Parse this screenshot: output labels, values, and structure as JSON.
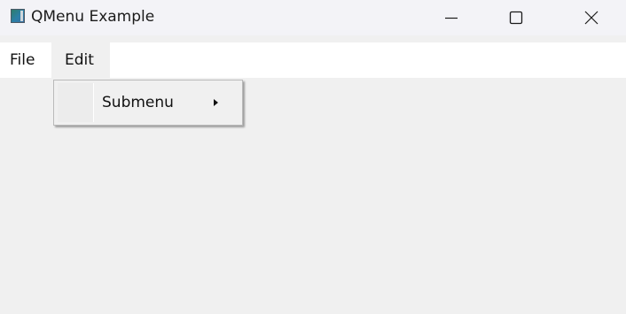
{
  "window": {
    "title": "QMenu Example",
    "icon": "app-window-icon",
    "controls": [
      "minimize-icon",
      "maximize-icon",
      "close-icon"
    ]
  },
  "menubar": {
    "items": [
      {
        "label": "File"
      },
      {
        "label": "Edit",
        "state": "open"
      }
    ]
  },
  "edit_menu": {
    "items": [
      {
        "label": "Submenu",
        "has_submenu": true,
        "icon": "submenu-arrow-icon"
      }
    ]
  }
}
